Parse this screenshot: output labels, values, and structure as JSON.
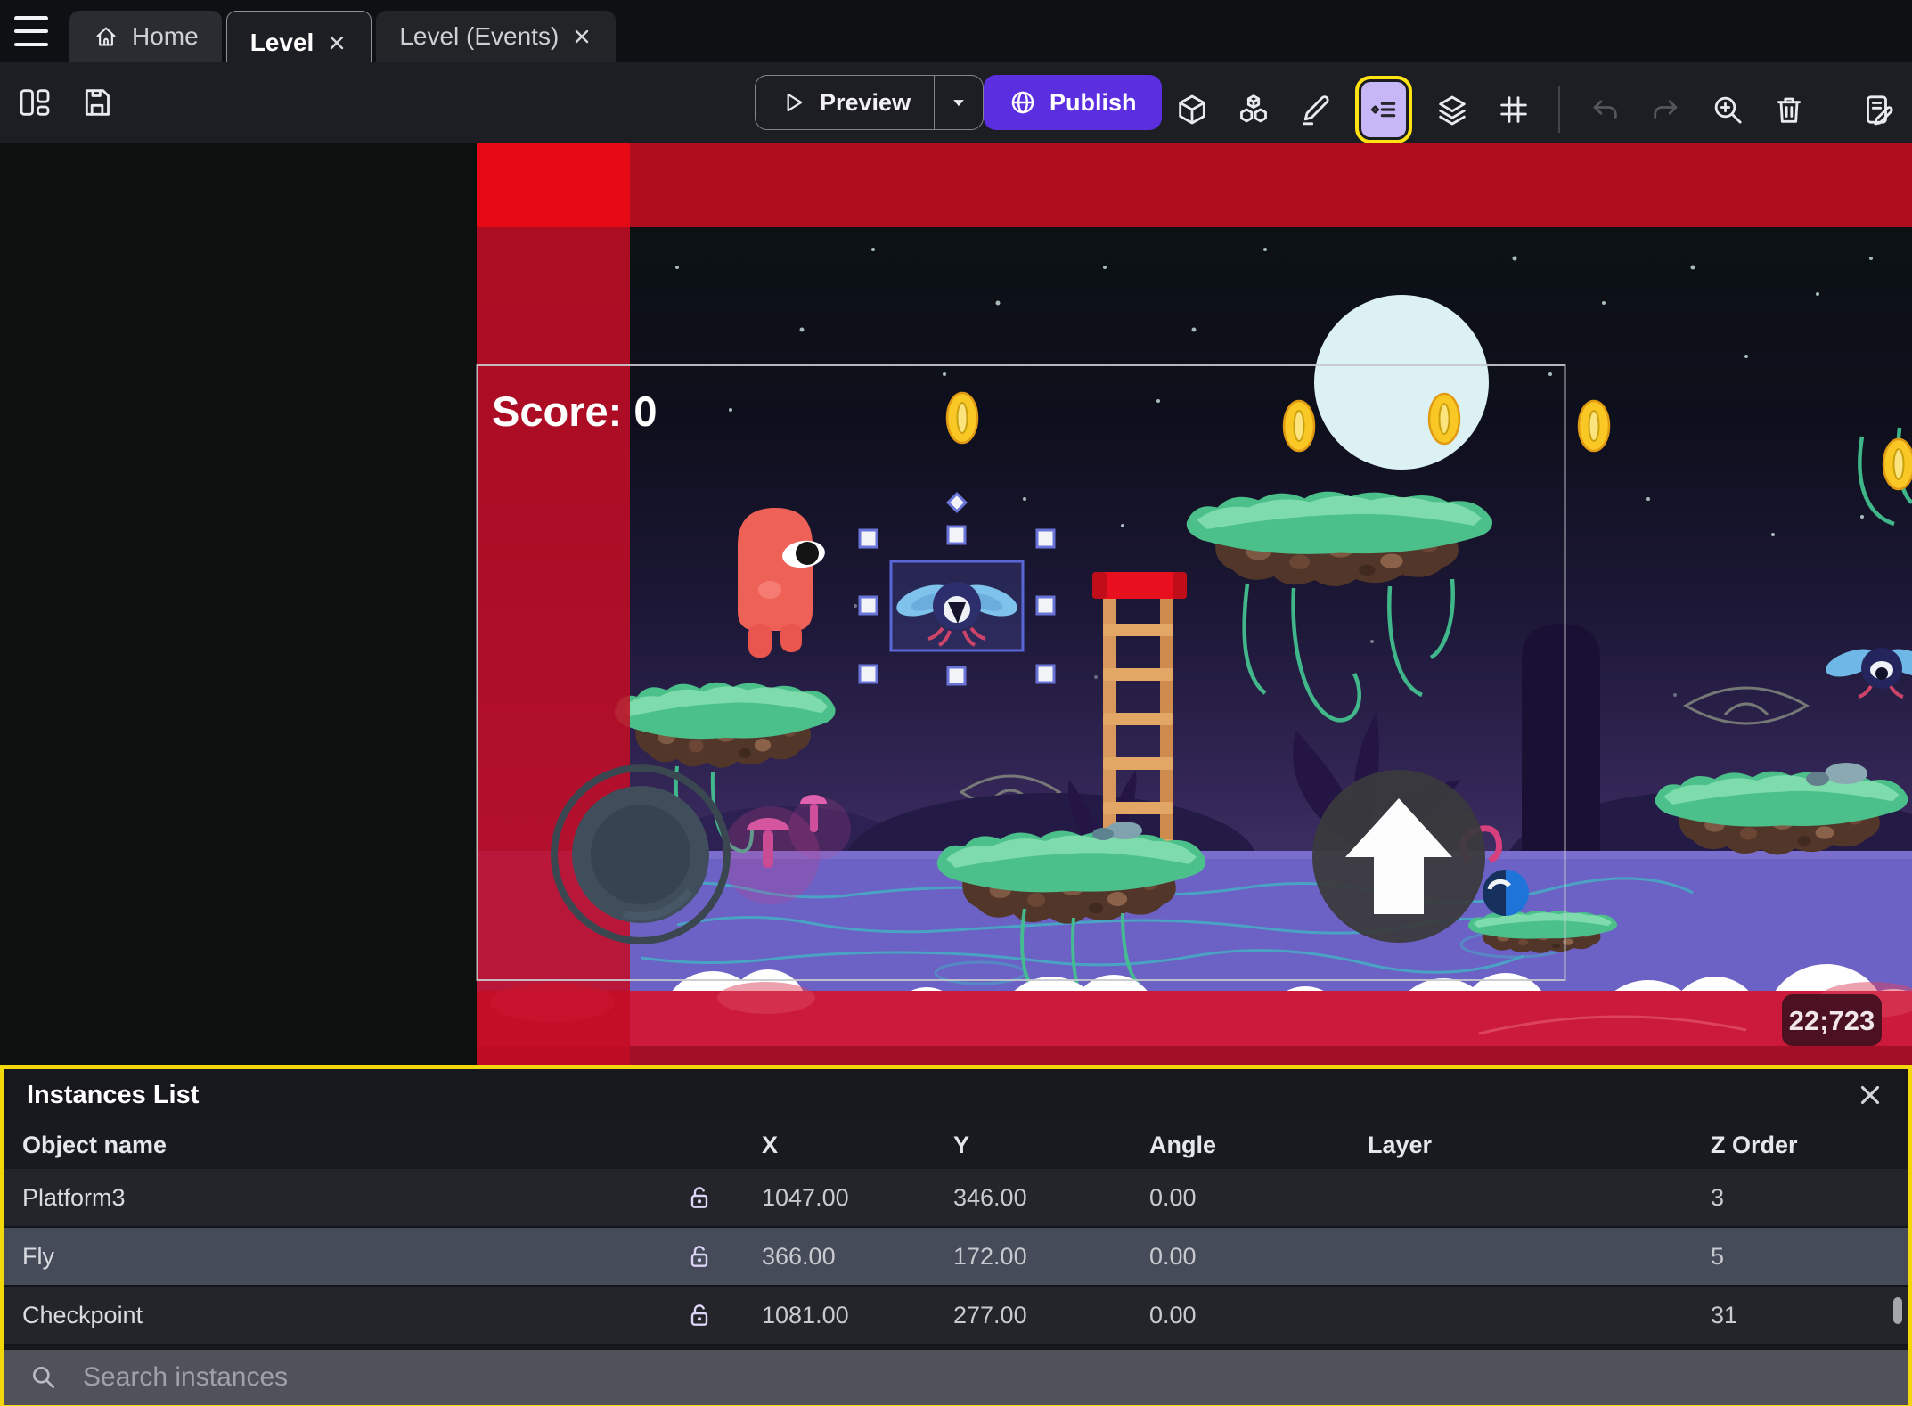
{
  "tab_bar": {
    "tabs": [
      {
        "label": "Home",
        "icon": "home-icon",
        "active": false,
        "closable": false
      },
      {
        "label": "Level",
        "active": true,
        "closable": true
      },
      {
        "label": "Level (Events)",
        "active": false,
        "closable": true
      }
    ]
  },
  "toolbar": {
    "preview_label": "Preview",
    "publish_label": "Publish",
    "left_icons": [
      "layout-panels-icon",
      "save-icon"
    ],
    "right_icons": [
      "box-3d-icon",
      "objects-icon",
      "pencil-icon",
      "instances-list-icon",
      "layers-icon",
      "grid-icon",
      "undo-icon",
      "redo-icon",
      "zoom-in-icon",
      "trash-icon",
      "edit-properties-icon"
    ],
    "highlighted_icon": "instances-list-icon"
  },
  "scene": {
    "score_label": "Score: 0",
    "coords_badge": "22;723",
    "selected_instance": "Fly"
  },
  "instances_panel": {
    "title": "Instances List",
    "columns": [
      "Object name",
      "X",
      "Y",
      "Angle",
      "Layer",
      "Z Order"
    ],
    "rows": [
      {
        "name": "Platform3",
        "locked": false,
        "x": "1047.00",
        "y": "346.00",
        "angle": "0.00",
        "layer": "",
        "z_order": "3",
        "selected": false
      },
      {
        "name": "Fly",
        "locked": false,
        "x": "366.00",
        "y": "172.00",
        "angle": "0.00",
        "layer": "",
        "z_order": "5",
        "selected": true
      },
      {
        "name": "Checkpoint",
        "locked": false,
        "x": "1081.00",
        "y": "277.00",
        "angle": "0.00",
        "layer": "",
        "z_order": "31",
        "selected": false
      }
    ],
    "search_placeholder": "Search instances"
  },
  "colors": {
    "accent_purple": "#5b2ee0",
    "highlight_yellow": "#ffe312",
    "panel_border_yellow": "#f2d80a",
    "selection_blue": "#5b66d6",
    "hud_red_strip": "#c30d25",
    "hud_red_band": "#b00d1f",
    "selected_row": "#454b58"
  }
}
